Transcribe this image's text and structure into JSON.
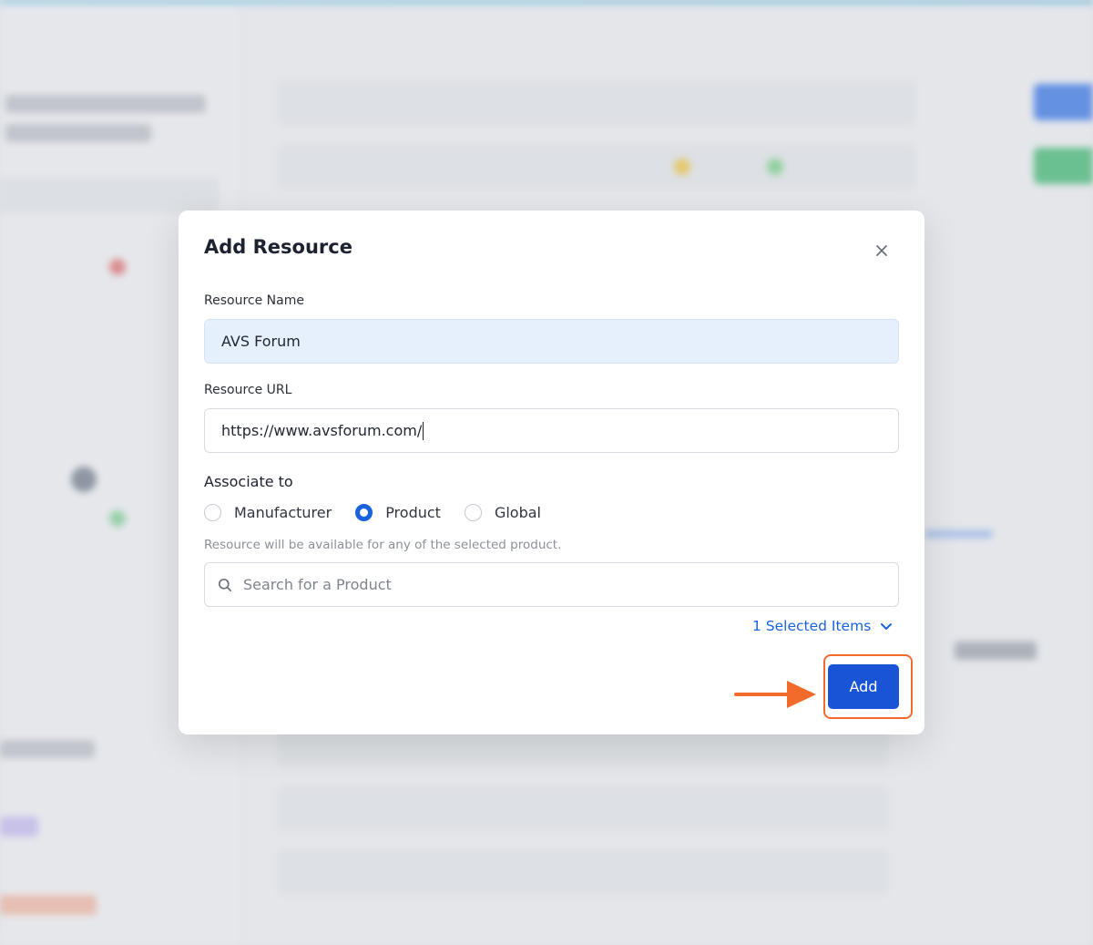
{
  "modal": {
    "title": "Add Resource",
    "resource_name": {
      "label": "Resource Name",
      "value": "AVS Forum"
    },
    "resource_url": {
      "label": "Resource URL",
      "value": "https://www.avsforum.com/"
    },
    "associate": {
      "title": "Associate to",
      "options": [
        "Manufacturer",
        "Product",
        "Global"
      ],
      "selected": "Product",
      "hint": "Resource will be available for any of the selected product."
    },
    "search": {
      "placeholder": "Search for a Product"
    },
    "selected_items_label": "1 Selected Items",
    "add_label": "Add"
  },
  "colors": {
    "primary": "#1953d6",
    "link": "#1a63e0",
    "highlight": "#f26b2a",
    "filled_input_bg": "#e6f0fd"
  },
  "icons": {
    "close": "close-icon",
    "search": "search-icon",
    "chevron": "chevron-down-icon",
    "arrow": "arrow-right-icon"
  }
}
